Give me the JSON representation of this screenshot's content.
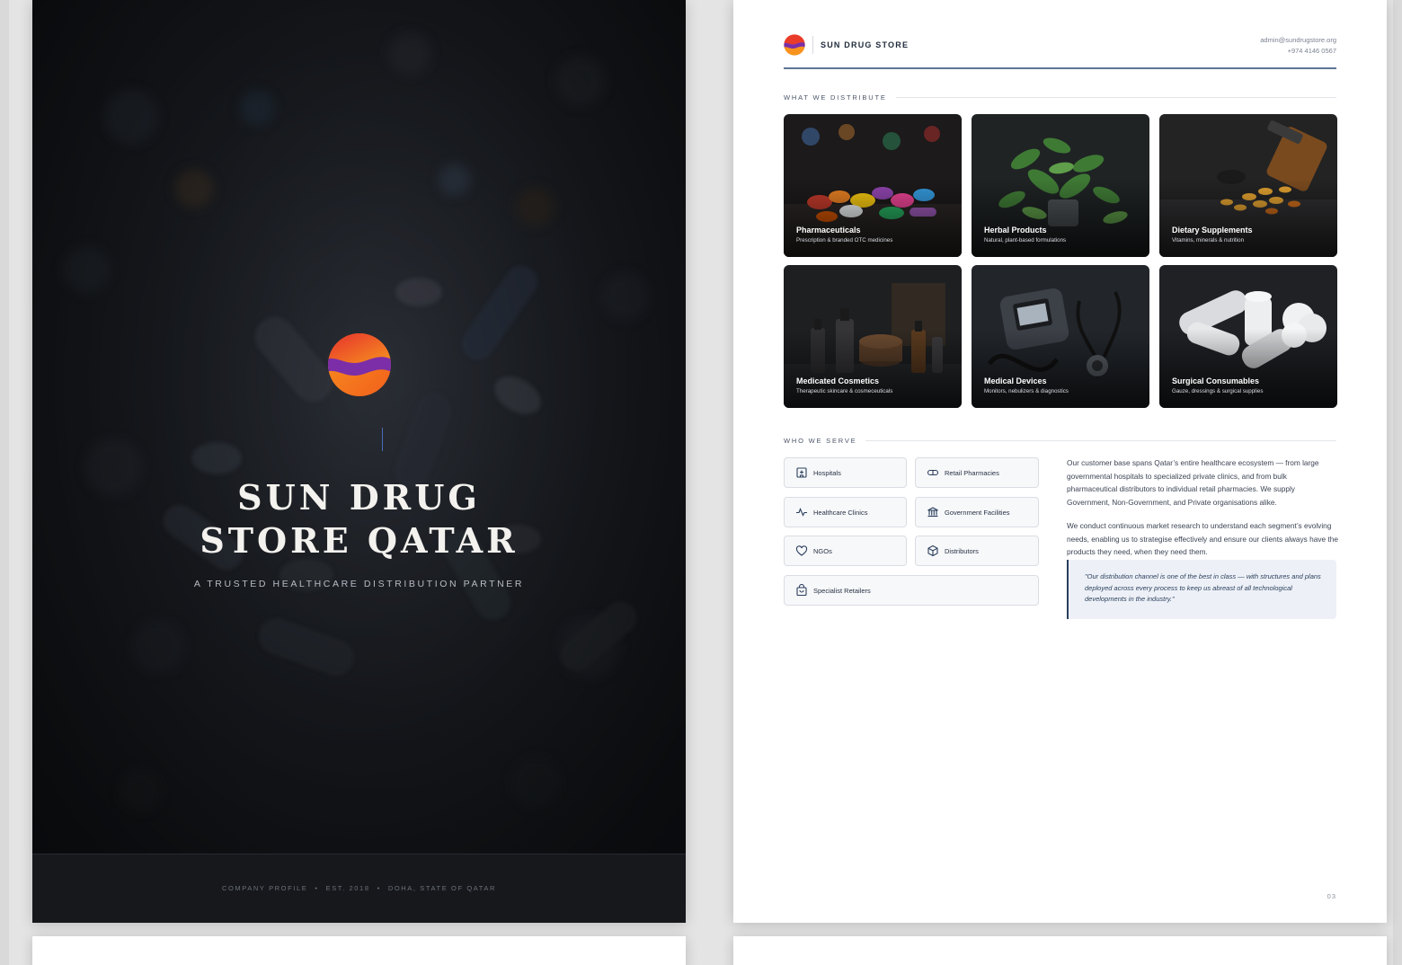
{
  "cover": {
    "title_line1": "SUN DRUG",
    "title_line2": "STORE QATAR",
    "subtitle": "A TRUSTED HEALTHCARE DISTRIBUTION PARTNER",
    "footer": [
      "COMPANY PROFILE",
      "EST. 2018",
      "DOHA, STATE OF QATAR"
    ]
  },
  "header": {
    "brand": "SUN DRUG STORE",
    "email": "admin@sundrugstore.org",
    "phone": "+974 4146 0567"
  },
  "distribute": {
    "label": "WHAT WE DISTRIBUTE",
    "items": [
      {
        "title": "Pharmaceuticals",
        "subtitle": "Prescription & branded OTC medicines"
      },
      {
        "title": "Herbal Products",
        "subtitle": "Natural, plant-based formulations"
      },
      {
        "title": "Dietary Supplements",
        "subtitle": "Vitamins, minerals & nutrition"
      },
      {
        "title": "Medicated Cosmetics",
        "subtitle": "Therapeutic skincare & cosmeceuticals"
      },
      {
        "title": "Medical Devices",
        "subtitle": "Monitors, nebulizers & diagnostics"
      },
      {
        "title": "Surgical Consumables",
        "subtitle": "Gauze, dressings & surgical supplies"
      }
    ]
  },
  "serve": {
    "label": "WHO WE SERVE",
    "chips": [
      {
        "label": "Hospitals",
        "icon": "hospital-icon"
      },
      {
        "label": "Retail Pharmacies",
        "icon": "pill-icon"
      },
      {
        "label": "Healthcare Clinics",
        "icon": "pulse-icon"
      },
      {
        "label": "Government Facilities",
        "icon": "building-columns-icon"
      },
      {
        "label": "NGOs",
        "icon": "heart-icon"
      },
      {
        "label": "Distributors",
        "icon": "box-icon"
      },
      {
        "label": "Specialist Retailers",
        "icon": "shopping-bag-icon"
      }
    ],
    "paragraph1": "Our customer base spans Qatar’s entire healthcare ecosystem — from large governmental hospitals to specialized private clinics, and from bulk pharmaceutical distributors to individual retail pharmacies. We supply Government, Non-Government, and Private organisations alike.",
    "paragraph2": "We conduct continuous market research to understand each segment’s evolving needs, enabling us to strategise effectively and ensure our clients always have the products they need, when they need them.",
    "quote": "\"Our distribution channel is one of the best in class — with structures and plans deployed across every process to keep us abreast of all technological developments in the industry.\""
  },
  "page_number": "03",
  "colors": {
    "cover_bg": "#1d2026",
    "accent_navy": "#2a3e5c",
    "logo_orange": "#f7931e",
    "logo_purple": "#7b2ea8"
  }
}
